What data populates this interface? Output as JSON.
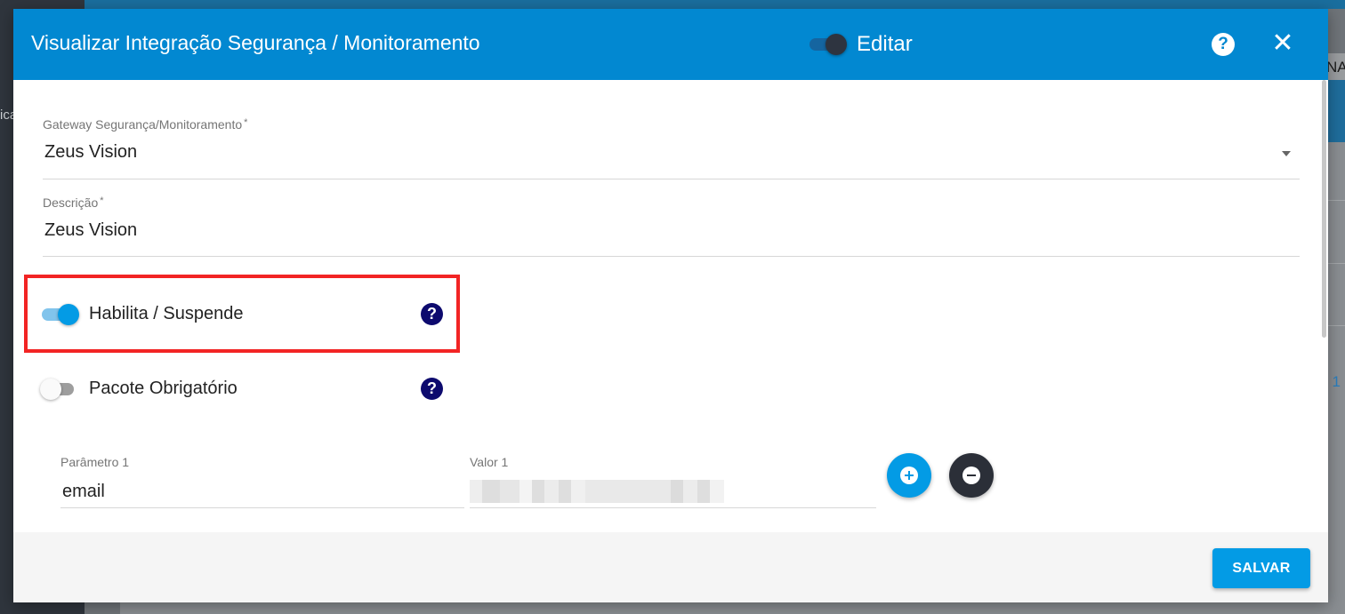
{
  "background": {
    "partial_header_text": "NA",
    "partial_sidebar_text": "ica",
    "partial_link_text": ": 1"
  },
  "modal": {
    "title": "Visualizar Integração Segurança / Monitoramento",
    "edit_label": "Editar",
    "edit_toggle_on": true,
    "help_glyph": "?",
    "close_glyph": "✕"
  },
  "form": {
    "gateway": {
      "label": "Gateway Segurança/Monitoramento",
      "required_mark": "*",
      "value": "Zeus Vision"
    },
    "descricao": {
      "label": "Descrição",
      "required_mark": "*",
      "value": "Zeus Vision"
    },
    "habilita": {
      "label": "Habilita / Suspende",
      "checked": true,
      "help_glyph": "?"
    },
    "pacote": {
      "label": "Pacote Obrigatório",
      "checked": false,
      "help_glyph": "?"
    },
    "params": [
      {
        "param_label": "Parâmetro 1",
        "param_value": "email",
        "value_label": "Valor 1"
      }
    ]
  },
  "footer": {
    "save_label": "SALVAR"
  },
  "colors": {
    "header_blue": "#0288d1",
    "accent_blue": "#039be5",
    "help_navy": "#0d0a6e",
    "highlight_red": "#f22424"
  }
}
